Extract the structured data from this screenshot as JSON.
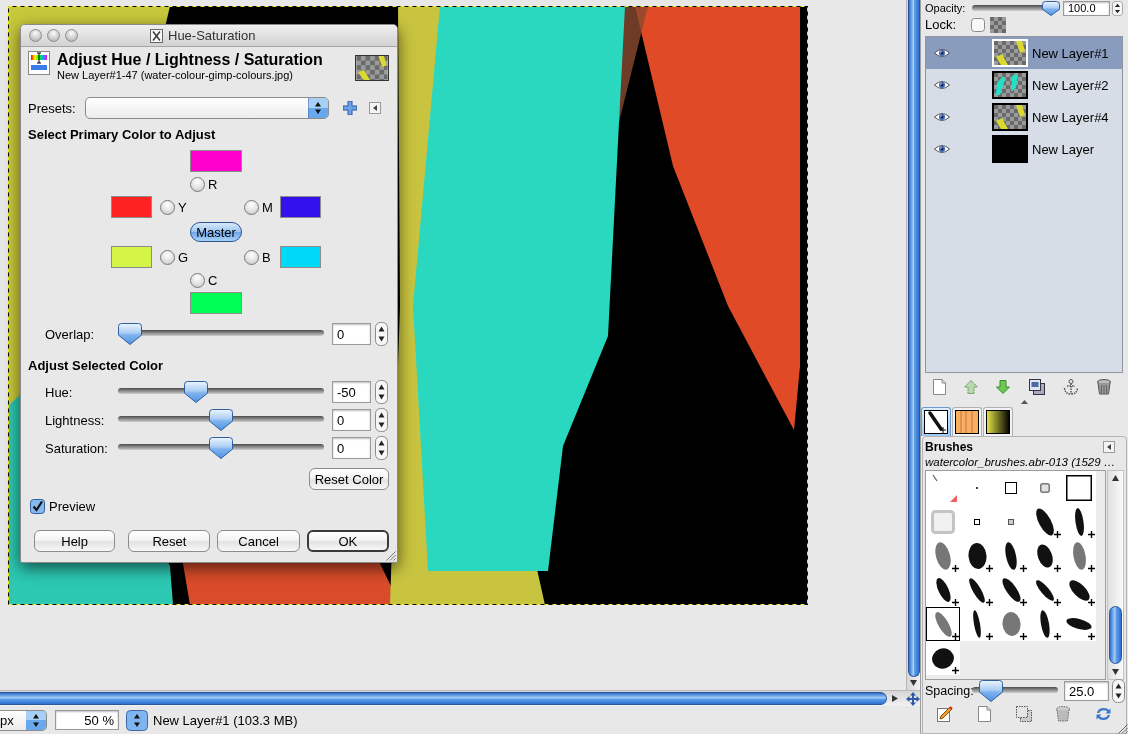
{
  "dialog": {
    "title": "Hue-Saturation",
    "heading": "Adjust Hue / Lightness / Saturation",
    "subheading": "New Layer#1-47 (water-colour-gimp-colours.jpg)",
    "presets_label": "Presets:",
    "primary_heading": "Select Primary Color to Adjust",
    "primaries": [
      {
        "label": "R",
        "color": "#ff00cc",
        "selected": false
      },
      {
        "label": "Y",
        "color": "#ff2222",
        "selected": false
      },
      {
        "label": "M",
        "color": "#3311ee",
        "selected": false
      },
      {
        "label": "G",
        "color": "#d4f548",
        "selected": false
      },
      {
        "label": "B",
        "color": "#00d8f8",
        "selected": false
      },
      {
        "label": "C",
        "color": "#00ff55",
        "selected": false
      }
    ],
    "master": {
      "label": "Master",
      "selected": true
    },
    "overlap": {
      "label": "Overlap:",
      "level": 0,
      "value": "0"
    },
    "adjust_heading": "Adjust Selected Color",
    "adjustments": [
      {
        "label": "Hue:",
        "level": 0.36,
        "value": "-50"
      },
      {
        "label": "Lightness:",
        "level": 0.5,
        "value": "0"
      },
      {
        "label": "Saturation:",
        "level": 0.5,
        "value": "0"
      }
    ],
    "reset_color": "Reset Color",
    "preview": {
      "label": "Preview",
      "checked": true
    },
    "buttons": [
      {
        "label": "Help",
        "default": false
      },
      {
        "label": "Reset",
        "default": false
      },
      {
        "label": "Cancel",
        "default": false
      },
      {
        "label": "OK",
        "default": true
      }
    ]
  },
  "layers": {
    "opacity_label": "Opacity:",
    "opacity": {
      "level": 1,
      "value": "100.0"
    },
    "lock_label": "Lock:",
    "lock_alpha": {
      "checked": false
    },
    "items": [
      {
        "name": "New Layer#1",
        "selected": true,
        "visible": true,
        "kind": "yellow-strokes"
      },
      {
        "name": "New Layer#2",
        "selected": false,
        "visible": true,
        "kind": "cyan-strokes"
      },
      {
        "name": "New Layer#4",
        "selected": false,
        "visible": true,
        "kind": "yellow-strokes"
      },
      {
        "name": "New Layer",
        "selected": false,
        "visible": true,
        "kind": "black-fill"
      }
    ]
  },
  "dock_tabs": [
    {
      "kind": "brushes",
      "selected": true
    },
    {
      "kind": "patterns",
      "selected": false
    },
    {
      "kind": "gradients",
      "selected": false
    }
  ],
  "brushes": {
    "title": "Brushes",
    "current": "watercolor_brushes.abr-013 (1529 …",
    "items": [
      {
        "kind": "pipe",
        "selected": false,
        "scaled": false
      },
      {
        "kind": "dot",
        "selected": false,
        "scaled": false
      },
      {
        "kind": "square",
        "selected": false,
        "scaled": false
      },
      {
        "kind": "soft-square",
        "selected": false,
        "scaled": false
      },
      {
        "kind": "large-square",
        "selected": false,
        "scaled": false
      },
      {
        "kind": "soft-large",
        "selected": false,
        "scaled": false
      },
      {
        "kind": "small-square",
        "selected": false,
        "scaled": false
      },
      {
        "kind": "small-soft",
        "selected": false,
        "scaled": false
      },
      {
        "kind": "stroke",
        "selected": false,
        "scaled": true
      },
      {
        "kind": "stroke",
        "selected": false,
        "scaled": true
      },
      {
        "kind": "stroke",
        "selected": false,
        "scaled": true
      },
      {
        "kind": "stroke",
        "selected": false,
        "scaled": true
      },
      {
        "kind": "stroke",
        "selected": false,
        "scaled": true
      },
      {
        "kind": "stroke",
        "selected": false,
        "scaled": true
      },
      {
        "kind": "stroke",
        "selected": false,
        "scaled": true
      },
      {
        "kind": "stroke",
        "selected": false,
        "scaled": true
      },
      {
        "kind": "stroke",
        "selected": false,
        "scaled": true
      },
      {
        "kind": "stroke",
        "selected": false,
        "scaled": true
      },
      {
        "kind": "stroke",
        "selected": false,
        "scaled": true
      },
      {
        "kind": "stroke",
        "selected": false,
        "scaled": true
      },
      {
        "kind": "stroke",
        "selected": true,
        "scaled": true
      },
      {
        "kind": "stroke",
        "selected": false,
        "scaled": true
      },
      {
        "kind": "stroke",
        "selected": false,
        "scaled": true
      },
      {
        "kind": "stroke",
        "selected": false,
        "scaled": true
      },
      {
        "kind": "stroke",
        "selected": false,
        "scaled": true
      },
      {
        "kind": "stroke",
        "selected": false,
        "scaled": true
      }
    ],
    "spacing": {
      "label": "Spacing:",
      "level": 0.12,
      "value": "25.0"
    }
  },
  "image_window": {
    "unit": "px",
    "zoom": "50 %",
    "status": "New Layer#1 (103.3 MB)"
  }
}
